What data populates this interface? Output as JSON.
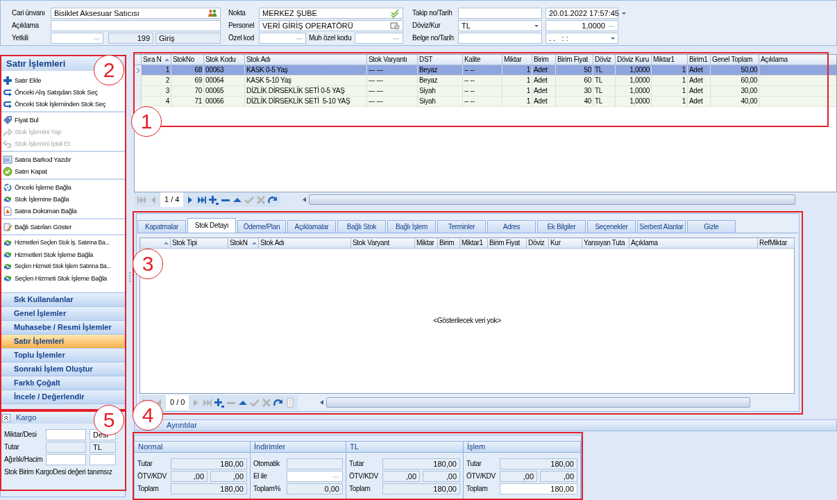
{
  "header": {
    "columns": [
      [
        {
          "label": "Cari ünvanı",
          "fields": [
            {
              "kind": "field",
              "value": "Bisiklet Aksesuar Satıcısı"
            }
          ]
        },
        {
          "label": "Açıklama",
          "fields": [
            {
              "kind": "field"
            }
          ]
        },
        {
          "label": "Yetkili",
          "fields": [
            {
              "kind": "lookup"
            },
            {
              "kind": "readonly-number",
              "value": "199"
            },
            {
              "kind": "readonly",
              "value": "Giriş"
            }
          ]
        }
      ],
      [
        {
          "label": "Nokta",
          "fields": [
            {
              "kind": "field",
              "value": "MERKEZ ŞUBE"
            }
          ]
        },
        {
          "label": "Personel",
          "fields": [
            {
              "kind": "field",
              "value": "VERİ GİRİŞ OPERATÖRÜ"
            }
          ]
        },
        {
          "label": "Özel kod",
          "fields": [
            {
              "kind": "lookup"
            },
            {
              "kind": "label",
              "text": "Muh özel kodu"
            },
            {
              "kind": "lookup"
            }
          ]
        }
      ],
      [
        {
          "label": "Takip no/Tarih",
          "fields": [
            {
              "kind": "field"
            },
            {
              "kind": "combo",
              "value": "20.01.2022 17:57:45"
            }
          ]
        },
        {
          "label": "Döviz/Kur",
          "fields": [
            {
              "kind": "combo",
              "value": "TL"
            },
            {
              "kind": "number-lookup",
              "value": "1,0000"
            }
          ]
        },
        {
          "label": "Belge no/Tarih",
          "fields": [
            {
              "kind": "field"
            },
            {
              "kind": "combo",
              "value": ". .   : :"
            }
          ]
        }
      ]
    ]
  },
  "actions": {
    "title": "Satır İşlemleri",
    "groups": [
      [
        {
          "label": "Satır Ekle",
          "disabled": false
        },
        {
          "label": "Önceki Alış Satışdan Stok Seç",
          "disabled": false
        },
        {
          "label": "Önceki Stok İşleminden Stok Seç",
          "disabled": false
        }
      ],
      [
        {
          "label": "Fiyat Bul",
          "disabled": false
        },
        {
          "label": "Stok İşlemini Yap",
          "disabled": true
        },
        {
          "label": "Stok İşlemini İptal Et",
          "disabled": true
        }
      ],
      [
        {
          "label": "Satıra Barkod Yazdır",
          "disabled": false
        },
        {
          "label": "Satırı Kapat",
          "disabled": false
        }
      ],
      [
        {
          "label": "Önceki İşleme Bağla",
          "disabled": false
        },
        {
          "label": "Stok İşlemine Bağla",
          "disabled": false
        },
        {
          "label": "Satıra Doküman Bağla",
          "disabled": false
        }
      ],
      [
        {
          "label": "Bağlı Satırları Göster",
          "disabled": false
        }
      ],
      [
        {
          "label": "Hizmetleri Seçlen Stok İş. Satırına Ba...",
          "disabled": false
        },
        {
          "label": "Hizmetleri Stok İşleme Bağla",
          "disabled": false
        },
        {
          "label": "Seçlen Hizmeti Stok İşlem Satırına Ba...",
          "disabled": false
        },
        {
          "label": "Seçlen Hizmeti Stok İşleme Bağla",
          "disabled": false
        }
      ]
    ]
  },
  "nav": [
    {
      "label": "Sık Kullanılanlar",
      "selected": false
    },
    {
      "label": "Genel İşlemler",
      "selected": false
    },
    {
      "label": "Muhasebe / Resmi İşlemler",
      "selected": false
    },
    {
      "label": "Satır İşlemleri",
      "selected": true
    },
    {
      "label": "Toplu İşlemler",
      "selected": false
    },
    {
      "label": "Sonraki İşlem Oluştur",
      "selected": false
    },
    {
      "label": "Farklı Çoğalt",
      "selected": false
    },
    {
      "label": "İncele / Değerlendir",
      "selected": false
    }
  ],
  "cargo": {
    "title": "Kargo",
    "rows": [
      {
        "label": "Miktar/Desi",
        "fields": [
          {
            "kind": "field"
          },
          {
            "kind": "field",
            "value": "Desi"
          }
        ]
      },
      {
        "label": "Tutar",
        "fields": [
          {
            "kind": "readonly"
          },
          {
            "kind": "readonly",
            "value": "TL"
          }
        ]
      },
      {
        "label": "Ağırlık/Hacim",
        "fields": [
          {
            "kind": "field"
          },
          {
            "kind": "field"
          }
        ]
      }
    ],
    "note": "Stok Birim KargoDesi değeri tanımsız"
  },
  "lines": {
    "columns": [
      {
        "label": "Sıra N",
        "sorted": true
      },
      {
        "label": "StokNo",
        "sorted": false
      },
      {
        "label": "Stok Kodu",
        "sorted": false
      },
      {
        "label": "Stok Adı",
        "sorted": false
      },
      {
        "label": "Stok Varyantı",
        "sorted": false
      },
      {
        "label": "DST",
        "sorted": false
      },
      {
        "label": "Kalite",
        "sorted": false
      },
      {
        "label": "Miktar",
        "sorted": false
      },
      {
        "label": "Birim",
        "sorted": false
      },
      {
        "label": "Birim Fiyat",
        "sorted": false
      },
      {
        "label": "Döviz",
        "sorted": false
      },
      {
        "label": "Döviz Kuru",
        "sorted": false
      },
      {
        "label": "Miktar1",
        "sorted": false
      },
      {
        "label": "Birim1",
        "sorted": false
      },
      {
        "label": "Genel Toplam",
        "sorted": false
      },
      {
        "label": "Açıklama",
        "sorted": false
      }
    ],
    "rows": [
      {
        "selected": true,
        "cells": [
          "1",
          "68",
          "00063",
          "KASK 0-5 Yaş",
          "--- ---",
          "Beyaz",
          "-- --",
          "1",
          "Adet",
          "50",
          "TL",
          "1,0000",
          "1",
          "Adet",
          "50,00"
        ]
      },
      {
        "selected": false,
        "cells": [
          "2",
          "69",
          "00064",
          "KASK 5-10 Yaş",
          "--- ---",
          "Beyaz",
          "-- --",
          "1",
          "Adet",
          "60",
          "TL",
          "1,0000",
          "1",
          "Adet",
          "60,00"
        ]
      },
      {
        "selected": false,
        "cells": [
          "3",
          "70",
          "00065",
          "DİZLİK DİRSEKLİK SETİ 0-5 YAŞ",
          "--- ---",
          "Siyah",
          "-- --",
          "1",
          "Adet",
          "30",
          "TL",
          "1,0000",
          "1",
          "Adet",
          "30,00"
        ]
      },
      {
        "selected": false,
        "cells": [
          "4",
          "71",
          "00066",
          "DİZLİK DİRSEKLİK SETİ  5-10 YAŞ",
          "--- ---",
          "Siyah",
          "-- --",
          "1",
          "Adet",
          "40",
          "TL",
          "1,0000",
          "1",
          "Adet",
          "40,00"
        ]
      }
    ],
    "pager": "1 / 4"
  },
  "detail": {
    "tabs": [
      {
        "label": "Kapatmalar",
        "selected": false
      },
      {
        "label": "Stok Detayı",
        "selected": true
      },
      {
        "label": "Ödeme/Plan",
        "selected": false
      },
      {
        "label": "Açıklamalar",
        "selected": false
      },
      {
        "label": "Bağlı Stok",
        "selected": false
      },
      {
        "label": "Bağlı İşlem",
        "selected": false
      },
      {
        "label": "Terminler",
        "selected": false
      },
      {
        "label": "Adres",
        "selected": false
      },
      {
        "label": "Ek Bilgiler",
        "selected": false
      },
      {
        "label": "Seçenekler",
        "selected": false
      },
      {
        "label": "Serbest Alanlar",
        "selected": false
      },
      {
        "label": "Gizle",
        "selected": false
      }
    ],
    "columns": [
      {
        "sorted": true
      },
      {
        "label": "Stok Tipi",
        "sorted": false
      },
      {
        "label": "StokN",
        "sorted": true
      },
      {
        "label": "Stok Adı",
        "sorted": false
      },
      {
        "label": "Stok Varyant",
        "sorted": false
      },
      {
        "label": "Miktar",
        "sorted": false
      },
      {
        "label": "Birim",
        "sorted": false
      },
      {
        "label": "Miktar1",
        "sorted": false
      },
      {
        "label": "Birim Fiyat",
        "sorted": false
      },
      {
        "label": "Döviz",
        "sorted": false
      },
      {
        "label": "Kur",
        "sorted": false
      },
      {
        "label": "Yansıyan Tuta",
        "sorted": false
      },
      {
        "label": "Açıklama",
        "sorted": false
      },
      {
        "label": "RefMiktar",
        "sorted": false
      }
    ],
    "empty_text": "<Gösterilecek veri yok>",
    "pager": "0 / 0"
  },
  "details_bar": {
    "title": "Ayrıntılar"
  },
  "totals": [
    {
      "title": "Normal",
      "rows": [
        {
          "label": "Tutar",
          "fields": [
            {
              "kind": "readonly",
              "value": "180,00"
            }
          ]
        },
        {
          "label": "ÖTV/KDV",
          "fields": [
            {
              "kind": "readonly",
              "value": ",00"
            },
            {
              "kind": "readonly",
              "value": ",00"
            }
          ]
        },
        {
          "label": "Toplam",
          "fields": [
            {
              "kind": "readonly",
              "value": "180,00"
            }
          ]
        }
      ]
    },
    {
      "title": "İndirimler",
      "rows": [
        {
          "label": "Otomatik",
          "fields": [
            {
              "kind": "readonly"
            }
          ]
        },
        {
          "label": "El ile",
          "fields": [
            {
              "kind": "lookup"
            }
          ]
        },
        {
          "label": "Toplam%",
          "fields": [
            {
              "kind": "readonly",
              "value": "0,00"
            }
          ]
        }
      ]
    },
    {
      "title": "TL",
      "rows": [
        {
          "label": "Tutar",
          "fields": [
            {
              "kind": "readonly",
              "value": "180,00"
            }
          ]
        },
        {
          "label": "ÖTV/KDV",
          "fields": [
            {
              "kind": "readonly",
              "value": ",00"
            },
            {
              "kind": "readonly",
              "value": ",00"
            }
          ]
        },
        {
          "label": "Toplam",
          "fields": [
            {
              "kind": "readonly",
              "value": "180,00"
            }
          ]
        }
      ]
    },
    {
      "title": "İşlem",
      "rows": [
        {
          "label": "Tutar",
          "fields": [
            {
              "kind": "readonly",
              "value": "180,00"
            }
          ]
        },
        {
          "label": "ÖTV/KDV",
          "fields": [
            {
              "kind": "readonly",
              "value": ",00"
            },
            {
              "kind": "readonly",
              "value": ",00"
            }
          ]
        },
        {
          "label": "Toplam",
          "fields": [
            {
              "kind": "editable",
              "value": "180,00"
            }
          ]
        }
      ]
    }
  ],
  "annotations": [
    {
      "label": "2"
    },
    {
      "label": "1"
    },
    {
      "label": "3"
    },
    {
      "label": "5"
    },
    {
      "label": "4"
    }
  ]
}
